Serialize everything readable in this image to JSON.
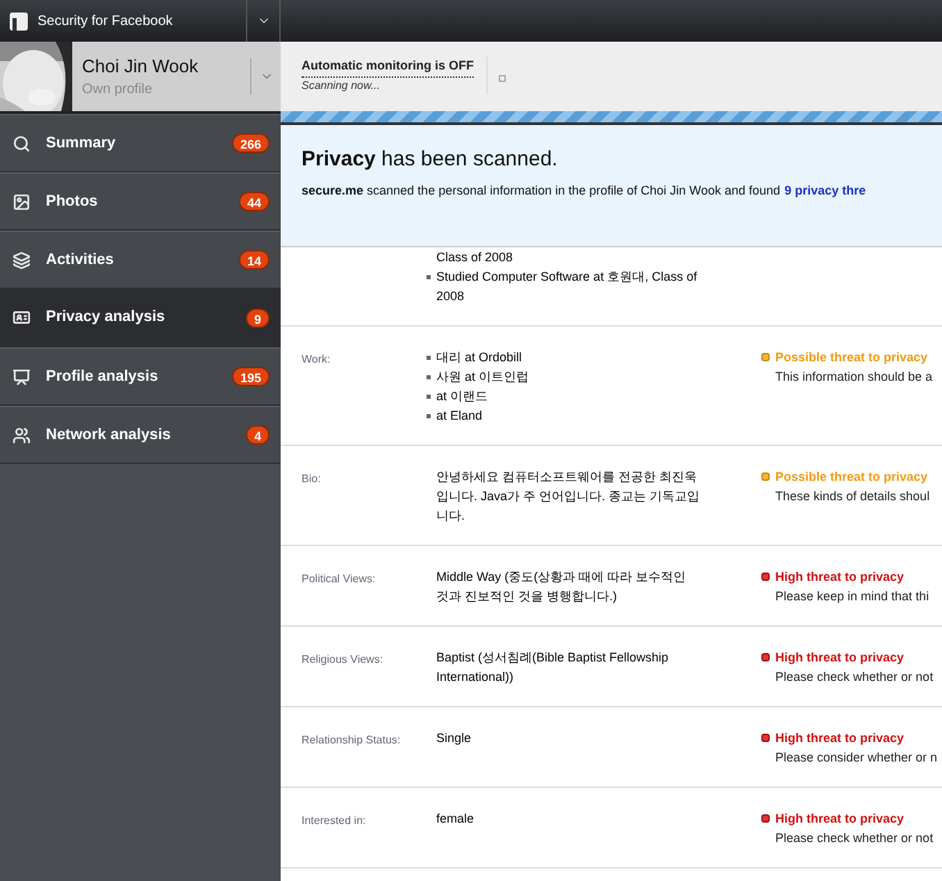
{
  "app_bar": {
    "title": "Security for Facebook"
  },
  "profile": {
    "name": "Choi Jin Wook",
    "subtitle": "Own profile"
  },
  "nav": [
    {
      "label": "Summary",
      "count": "266",
      "selected": false
    },
    {
      "label": "Photos",
      "count": "44",
      "selected": false
    },
    {
      "label": "Activities",
      "count": "14",
      "selected": false
    },
    {
      "label": "Privacy analysis",
      "count": "9",
      "selected": true
    },
    {
      "label": "Profile analysis",
      "count": "195",
      "selected": false
    },
    {
      "label": "Network analysis",
      "count": "4",
      "selected": false
    }
  ],
  "status": {
    "monitoring": "Automatic monitoring is OFF",
    "scanning": "Scanning now..."
  },
  "banner": {
    "title": "**Privacy** has been scanned.",
    "text": "**secure.me** scanned the personal information in the profile of Choi Jin Wook and found",
    "link": "9 privacy thre"
  },
  "rows": [
    {
      "kind": "list",
      "continued": "Class of 2008",
      "items": [
        "Studied Computer Software at 호원대, Class of 2008"
      ]
    },
    {
      "kind": "list",
      "label": "Work:",
      "items": [
        "대리 at Ordobill",
        "사원 at 이트인럽",
        "at 이랜드",
        "at Eland"
      ],
      "threat": {
        "kind": "possible",
        "title": "Possible threat to privacy",
        "detail": "This information should be a"
      }
    },
    {
      "kind": "text",
      "label": "Bio:",
      "text": "안녕하세요 컴퓨터소프트웨어를 전공한 최진욱입니다. Java가 주 언어입니다. 종교는 기독교입니다.",
      "threat": {
        "kind": "possible",
        "title": "Possible threat to privacy",
        "detail": "These kinds of details shoul"
      }
    },
    {
      "kind": "text",
      "label": "Political Views:",
      "text": "Middle Way (중도(상황과 때에 따라 보수적인 것과 진보적인 것을 병행합니다.)",
      "threat": {
        "kind": "high",
        "title": "High threat to privacy",
        "detail": "Please keep in mind that thi"
      }
    },
    {
      "kind": "text",
      "label": "Religious Views:",
      "text": "Baptist (성서침례(Bible Baptist Fellowship International))",
      "threat": {
        "kind": "high",
        "title": "High threat to privacy",
        "detail": "Please check whether or not"
      }
    },
    {
      "kind": "text",
      "label": "Relationship Status:",
      "text": "Single",
      "threat": {
        "kind": "high",
        "title": "High threat to privacy",
        "detail": "Please consider whether or n"
      }
    },
    {
      "kind": "text",
      "label": "Interested in:",
      "text": "female",
      "threat": {
        "kind": "high",
        "title": "High threat to privacy",
        "detail": "Please check whether or not"
      }
    }
  ]
}
